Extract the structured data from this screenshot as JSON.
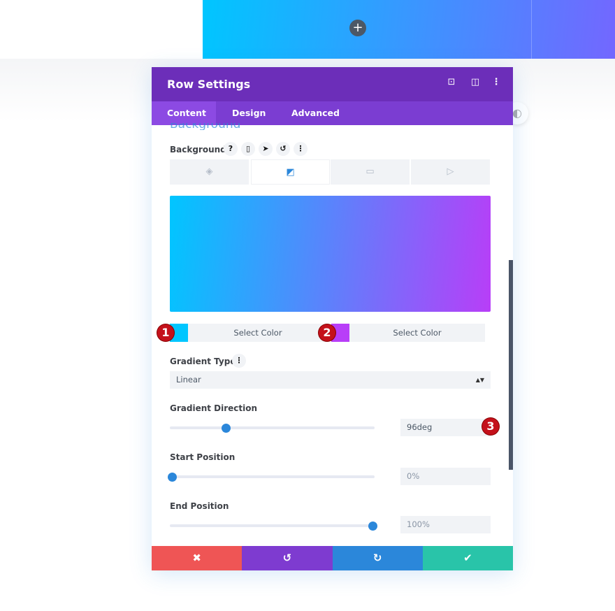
{
  "page": {
    "add_icon": "plus-icon"
  },
  "modal": {
    "title": "Row Settings",
    "header_icons": [
      "focus-icon",
      "split-view-icon",
      "more-vertical-icon"
    ],
    "tabs": [
      {
        "label": "Content",
        "active": true
      },
      {
        "label": "Design"
      },
      {
        "label": "Advanced"
      }
    ],
    "section_title": "Background",
    "background": {
      "label": "Background",
      "icons": [
        "help-icon",
        "mobile-icon",
        "hover-pointer-icon",
        "reset-icon",
        "more-vertical-icon"
      ],
      "type_tabs": [
        "color-icon",
        "gradient-icon",
        "image-icon",
        "video-icon"
      ],
      "active_type": "gradient"
    },
    "gradient": {
      "color1": "#00c6ff",
      "color2": "#b83ef8",
      "select_color_label": "Select Color",
      "type_label": "Gradient Type",
      "type_value": "Linear",
      "direction_label": "Gradient Direction",
      "direction_value": "96deg",
      "direction_deg": 96,
      "start_label": "Start Position",
      "start_value": "0%",
      "start_pct": 0,
      "end_label": "End Position",
      "end_value": "100%",
      "end_pct": 100
    },
    "badges": [
      "1",
      "2",
      "3"
    ],
    "footer": {
      "cancel": "✖",
      "undo": "↺",
      "redo": "↻",
      "save": "✔",
      "colors": {
        "cancel": "#ef5555",
        "undo": "#7e3bd0",
        "redo": "#2b87da",
        "save": "#29c4a9"
      }
    }
  }
}
